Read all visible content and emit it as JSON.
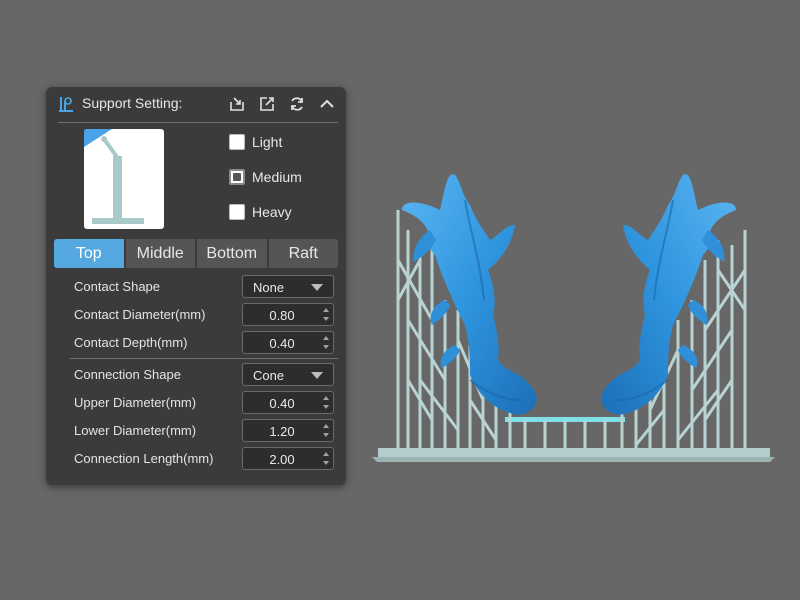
{
  "panel": {
    "title": "Support Setting:",
    "header_icons": [
      "import-icon",
      "export-icon",
      "refresh-icon",
      "collapse-chevron-up-icon"
    ],
    "density_options": [
      {
        "label": "Light",
        "selected": false
      },
      {
        "label": "Medium",
        "selected": true
      },
      {
        "label": "Heavy",
        "selected": false
      }
    ],
    "tabs": [
      {
        "label": "Top",
        "active": true
      },
      {
        "label": "Middle",
        "active": false
      },
      {
        "label": "Bottom",
        "active": false
      },
      {
        "label": "Raft",
        "active": false
      }
    ],
    "contact": {
      "shape_label": "Contact Shape",
      "shape_value": "None",
      "diameter_label": "Contact Diameter(mm)",
      "diameter_value": "0.80",
      "depth_label": "Contact Depth(mm)",
      "depth_value": "0.40"
    },
    "connection": {
      "shape_label": "Connection Shape",
      "shape_value": "Cone",
      "upper_label": "Upper Diameter(mm)",
      "upper_value": "0.40",
      "lower_label": "Lower Diameter(mm)",
      "lower_value": "1.20",
      "length_label": "Connection Length(mm)",
      "length_value": "2.00"
    }
  },
  "colors": {
    "viewport_bg": "#676767",
    "panel_bg": "#3b3b3b",
    "accent": "#55a8e0",
    "model_blue": "#3d9fe6",
    "support": "#a9c9c9"
  }
}
